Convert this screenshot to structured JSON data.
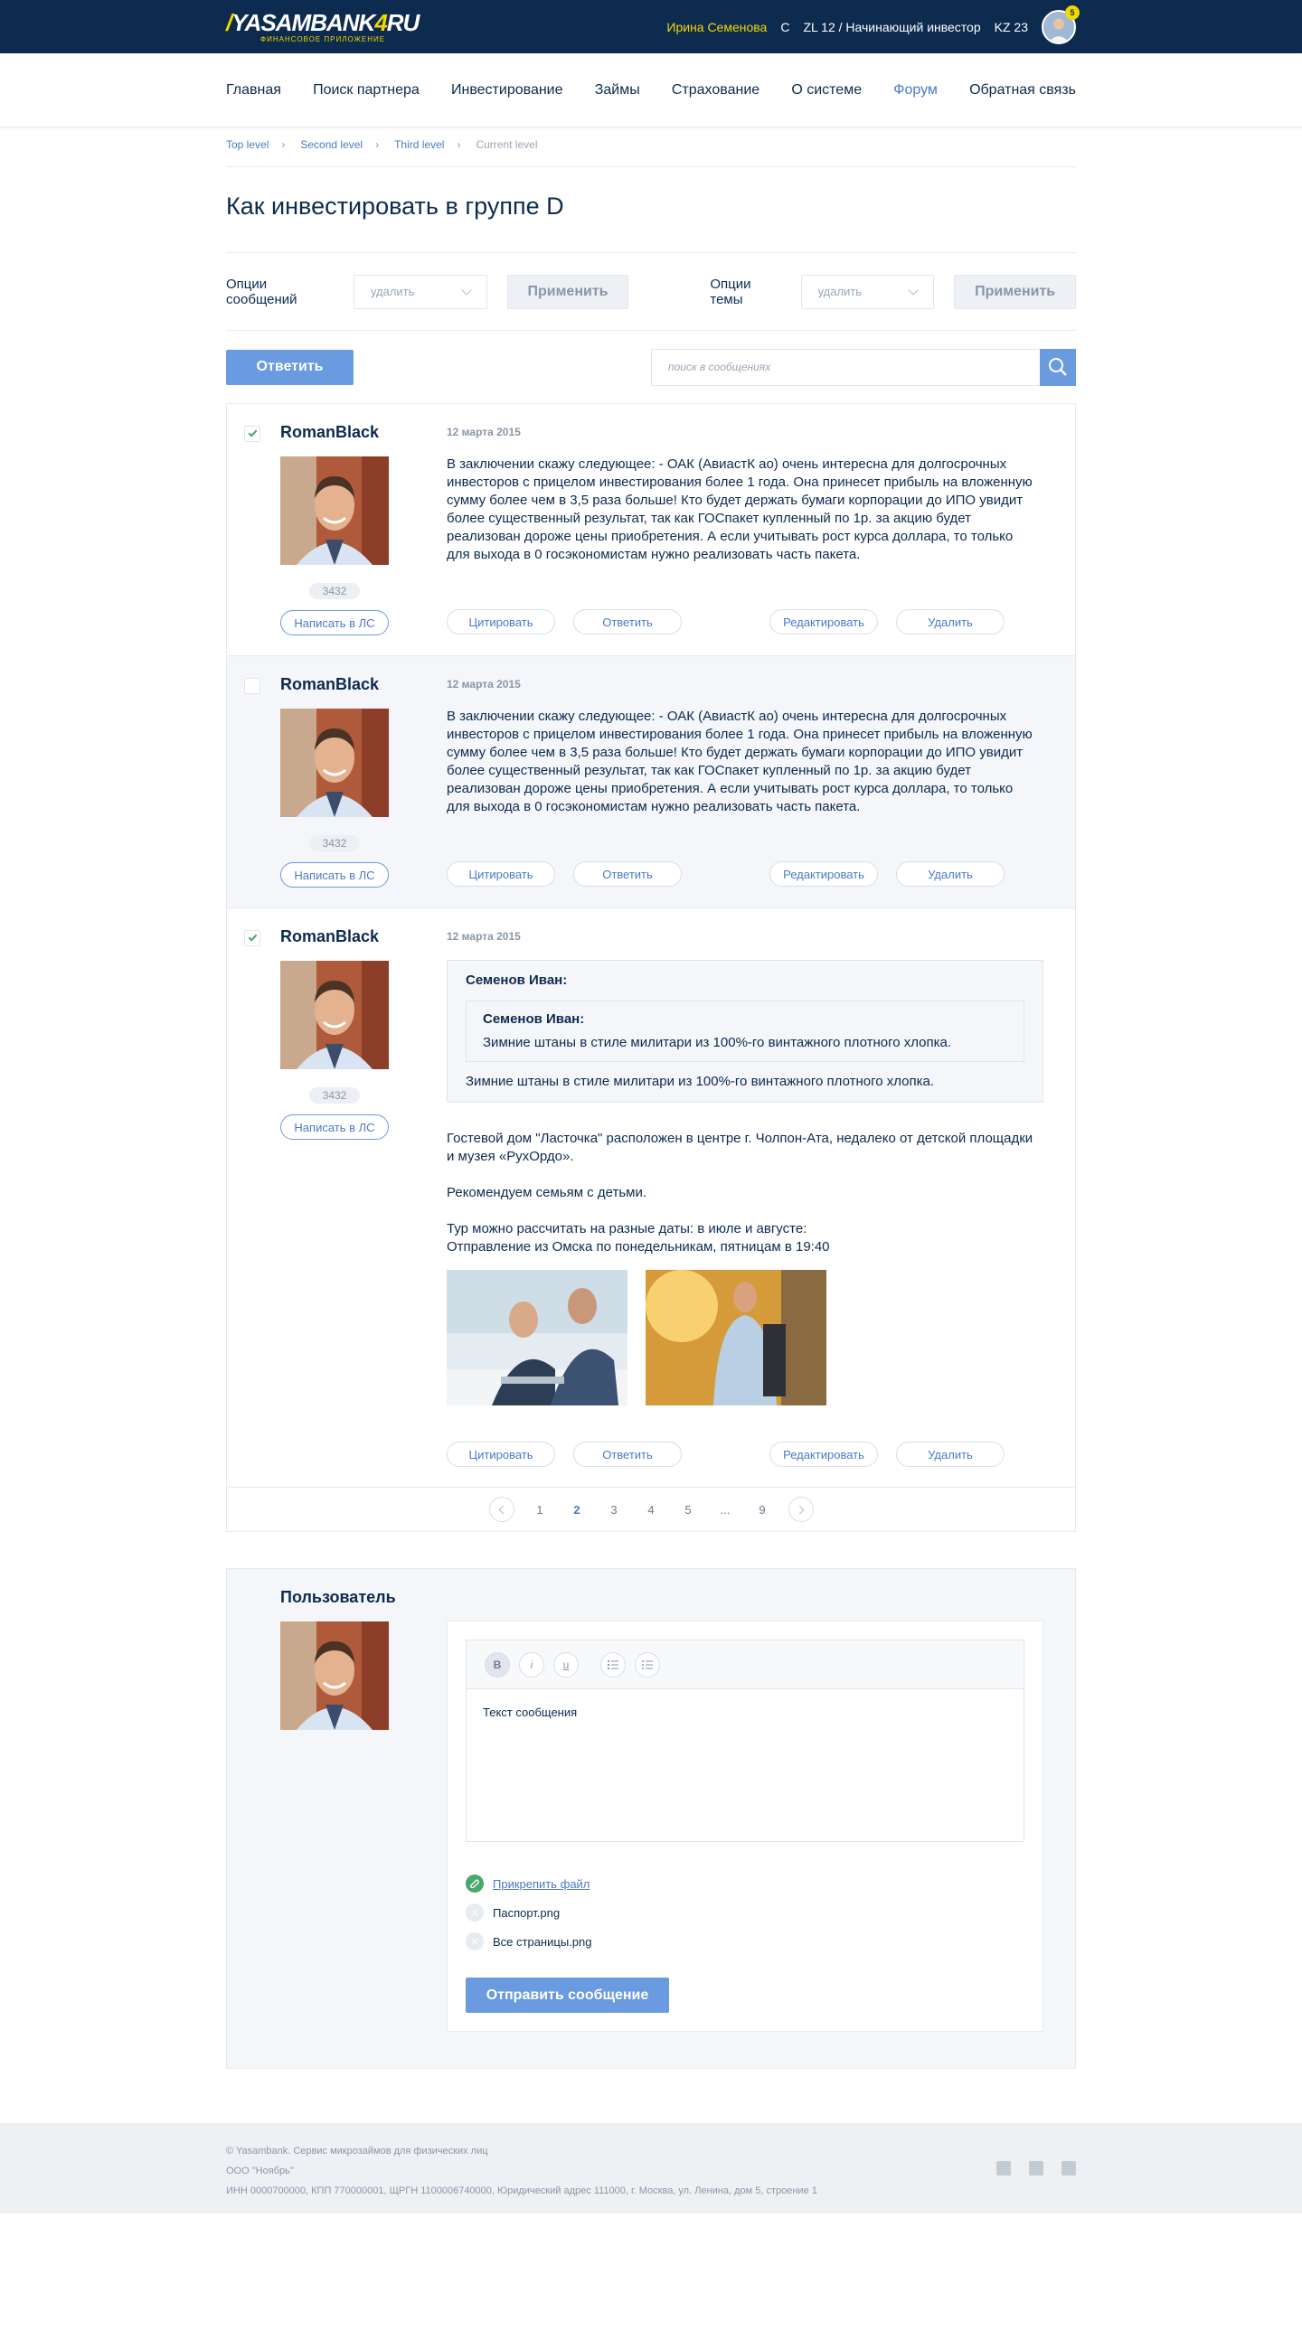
{
  "header": {
    "logo_text": "YASAMBANK",
    "logo_tld": "RU",
    "logo_sub": "ФИНАНСОВОЕ ПРИЛОЖЕНИЕ",
    "user_name": "Ирина Семенова",
    "status_c": "C",
    "level": "ZL 12 / Начинающий инвестор",
    "kz": "KZ 23",
    "notifications": "5"
  },
  "nav": {
    "items": [
      "Главная",
      "Поиск партнера",
      "Инвестирование",
      "Займы",
      "Страхование",
      "О системе",
      "Форум",
      "Обратная связь"
    ],
    "active": "Форум"
  },
  "breadcrumb": [
    "Top level",
    "Second level",
    "Third level",
    "Current level"
  ],
  "page_title": "Как инвестировать в группе D",
  "options": {
    "messages_label": "Опции сообщений",
    "messages_select": "удалить",
    "apply": "Применить",
    "topic_label": "Опции темы",
    "topic_select": "удалить"
  },
  "reply_button": "Ответить",
  "search_placeholder": "поиск в сообщениях",
  "posts": [
    {
      "author": "RomanBlack",
      "date": "12 марта 2015",
      "rating": "3432",
      "pm": "Написать в ЛС",
      "checked": true,
      "text": "В заключении скажу следующее: - ОАК (АвиастК ао) очень интересна для долгосрочных инвесторов с прицелом инвестирования более 1 года. Она принесет прибыль на вложенную сумму более чем в 3,5 раза больше! Кто будет держать бумаги корпорации до ИПО увидит более существенный результат, так как ГОСпакет купленный по 1р. за акцию будет реализован дороже цены приобретения. А если учитывать рост курса доллара, то только для выхода в 0 госэкономистам нужно реализовать часть пакета."
    },
    {
      "author": "RomanBlack",
      "date": "12 марта 2015",
      "rating": "3432",
      "pm": "Написать в ЛС",
      "checked": false,
      "text": "В заключении скажу следующее: - ОАК (АвиастК ао) очень интересна для долгосрочных инвесторов с прицелом инвестирования более 1 года. Она принесет прибыль на вложенную сумму более чем в 3,5 раза больше! Кто будет держать бумаги корпорации до ИПО увидит более существенный результат, так как ГОСпакет купленный по 1р. за акцию будет реализован дороже цены приобретения. А если учитывать рост курса доллара, то только для выхода в 0 госэкономистам нужно реализовать часть пакета."
    },
    {
      "author": "RomanBlack",
      "date": "12 марта 2015",
      "rating": "3432",
      "pm": "Написать в ЛС",
      "checked": true,
      "quote": {
        "name": "Семенов Иван:",
        "inner_name": "Семенов Иван:",
        "inner_text": "Зимние штаны в стиле милитари из 100%-го винтажного плотного хлопка.",
        "text": "Зимние штаны в стиле милитари из 100%-го винтажного плотного хлопка."
      },
      "p1": "Гостевой дом \"Ласточка\" расположен в центре г. Чолпон-Ата, недалеко от детской площадки и музея «РухОрдо».",
      "p2": "Рекомендуем семьям с детьми.",
      "p3a": "Тур можно рассчитать на разные даты: в июле и августе:",
      "p3b": "Отправление из Омска по понедельникам, пятницам в 19:40"
    }
  ],
  "post_actions": {
    "quote": "Цитировать",
    "reply": "Ответить",
    "edit": "Редактировать",
    "delete": "Удалить"
  },
  "pagination": {
    "pages": [
      "1",
      "2",
      "3",
      "4",
      "5",
      "...",
      "9"
    ],
    "current": "2"
  },
  "form": {
    "user_label": "Пользователь",
    "toolbar": [
      "B",
      "i",
      "u"
    ],
    "editor_text": "Текст сообщения",
    "attach": "Прикрепить файл",
    "files": [
      "Паспорт.png",
      "Все страницы.png"
    ],
    "send": "Отправить сообщение"
  },
  "footer": {
    "line1": "© Yasambank. Сервис микрозаймов для физических лиц",
    "line2": "ООО \"Ноябрь\"",
    "line3": "ИНН 0000700000, КПП 770000001, ЩРГН 1100006740000, Юридический адрес 111000, г. Москва, ул. Ленина, дом 5, строение 1"
  },
  "colors": {
    "header_bg": "#0d2a4f",
    "accent": "#6a9ae0",
    "link": "#4a7ac6",
    "highlight": "#f0d800",
    "check": "#4aa76c"
  }
}
